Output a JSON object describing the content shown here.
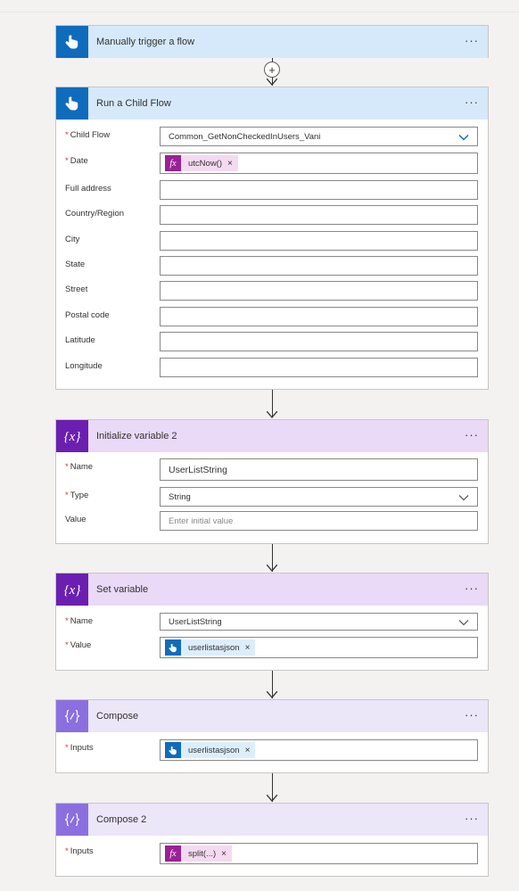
{
  "trigger": {
    "title": "Manually trigger a flow",
    "more": "···"
  },
  "connector_add": "+",
  "child_flow": {
    "title": "Run a Child Flow",
    "more": "···",
    "fields": [
      {
        "label": "Child Flow",
        "required": true,
        "value": "Common_GetNonCheckedInUsers_Vani"
      },
      {
        "label": "Date",
        "required": true,
        "token": "utcNow()"
      },
      {
        "label": "Full address"
      },
      {
        "label": "Country/Region"
      },
      {
        "label": "City"
      },
      {
        "label": "State"
      },
      {
        "label": "Street"
      },
      {
        "label": "Postal code"
      },
      {
        "label": "Latitude"
      },
      {
        "label": "Longitude"
      }
    ]
  },
  "init_var": {
    "title": "Initialize variable 2",
    "more": "···",
    "name_label": "Name",
    "name_value": "UserListString",
    "type_label": "Type",
    "type_value": "String",
    "value_label": "Value",
    "value_placeholder": "Enter initial value"
  },
  "set_var": {
    "title": "Set variable",
    "more": "···",
    "name_label": "Name",
    "name_value": "UserListString",
    "value_label": "Value",
    "value_token": "userlistasjson"
  },
  "compose1": {
    "title": "Compose",
    "more": "···",
    "inputs_label": "Inputs",
    "inputs_token": "userlistasjson"
  },
  "compose2": {
    "title": "Compose 2",
    "more": "···",
    "inputs_label": "Inputs",
    "inputs_token": "split(...)"
  },
  "req_mark": "*",
  "token_close": "×",
  "fx_glyph": "fx",
  "icons": {
    "trigger": "touch-hand-icon",
    "variable": "variable-braces-icon",
    "compose": "compose-icon",
    "expression": "fx-icon",
    "dynamic": "touch-hand-icon"
  },
  "colors": {
    "trigger_header": "#d6e9fb",
    "trigger_icon": "#0f6cbd",
    "variable_header": "#ead9f7",
    "variable_icon": "#6b1fb1",
    "compose_header": "#ece6f9",
    "compose_icon": "#8b6fe0",
    "fx_token": "#9a2196",
    "required": "#d13438"
  }
}
